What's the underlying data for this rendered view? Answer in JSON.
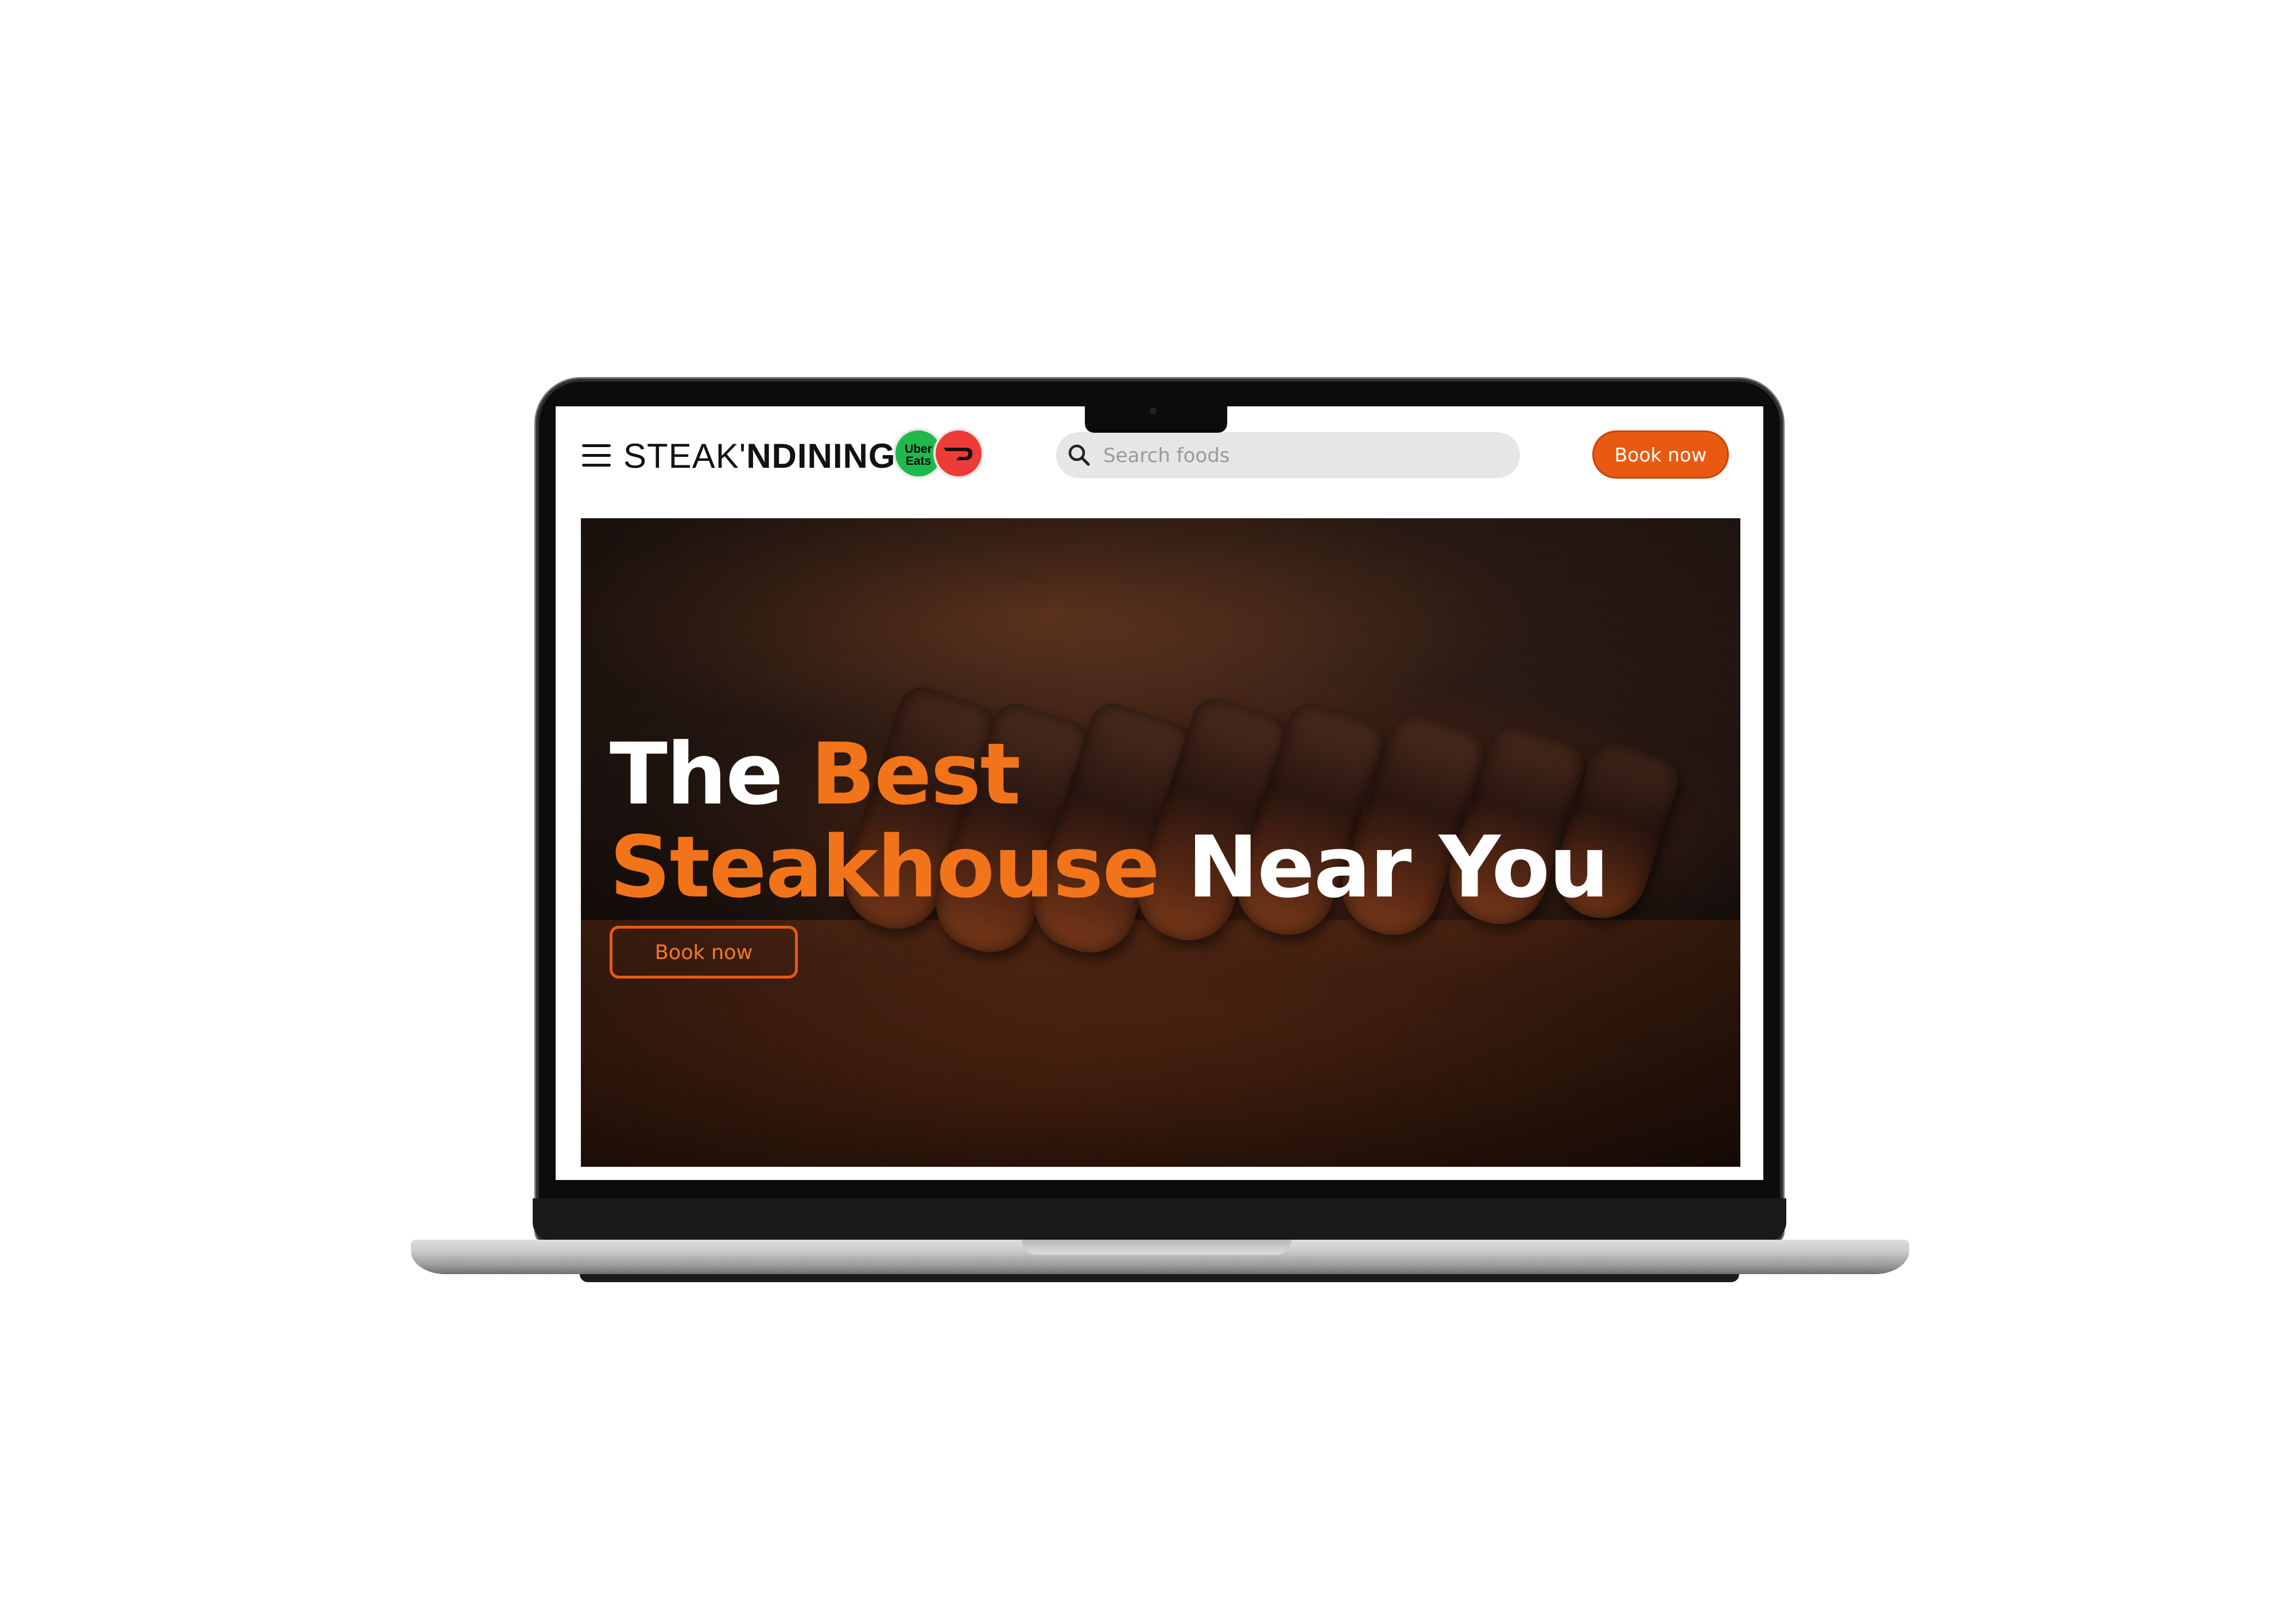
{
  "header": {
    "brand_light": "STEAK'",
    "brand_bold": "NDINING",
    "delivery": {
      "uber_line1": "Uber",
      "uber_line2": "Eats",
      "uber_color": "#1fb94b",
      "doordash_color": "#ef3b38"
    },
    "search": {
      "placeholder": "Search foods",
      "value": ""
    },
    "book_label": "Book now"
  },
  "hero": {
    "headline_line1_white": "The ",
    "headline_line1_orange": "Best",
    "headline_line2_orange": "Steakhouse",
    "headline_line2_white": " Near You",
    "book_label": "Book now"
  },
  "colors": {
    "accent": "#e85a12",
    "headline_accent": "#f2741a",
    "search_bg": "#e6e6e8"
  },
  "icons": {
    "menu": "hamburger-menu-icon",
    "search": "magnifier-icon",
    "uber_eats": "uber-eats-logo",
    "doordash": "doordash-logo"
  }
}
